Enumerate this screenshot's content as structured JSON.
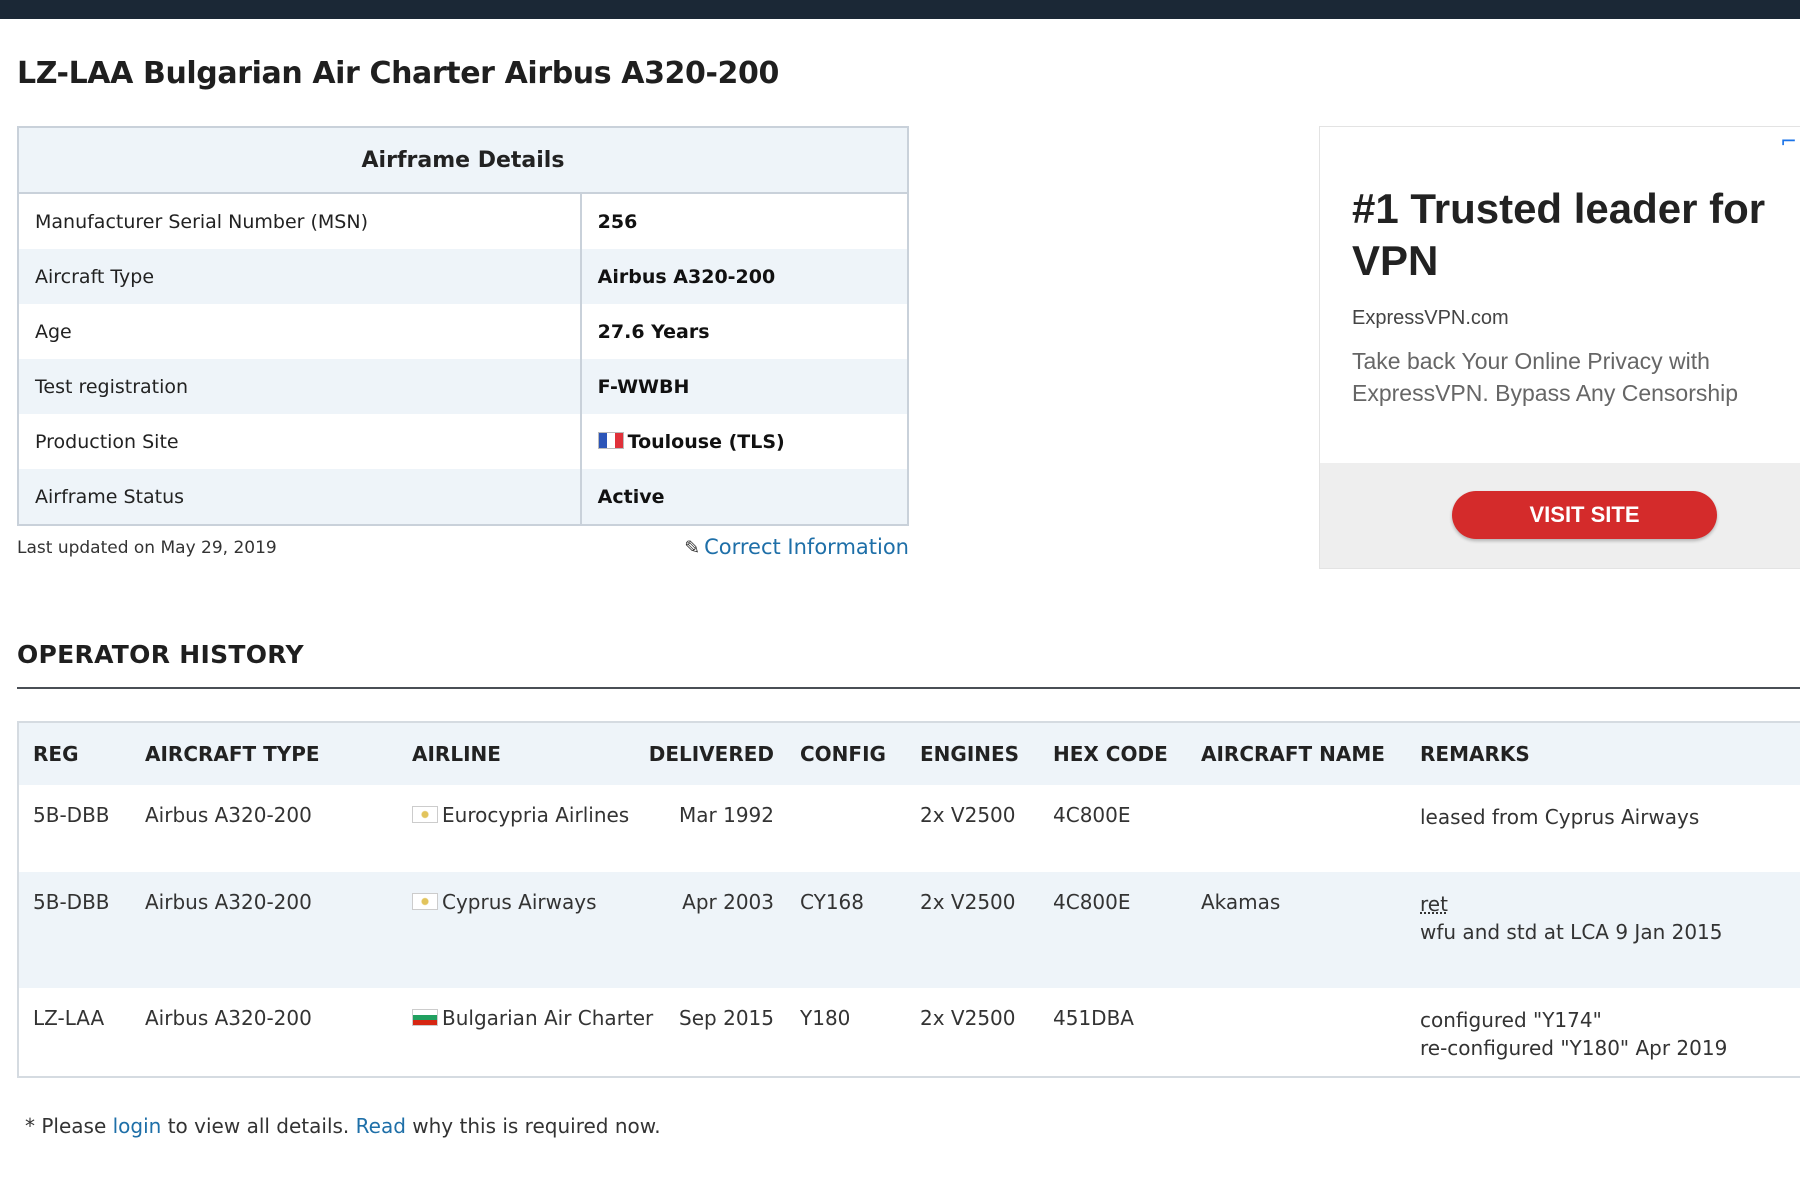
{
  "page": {
    "title": "LZ-LAA Bulgarian Air Charter Airbus A320-200"
  },
  "airframe": {
    "heading": "Airframe Details",
    "rows": [
      {
        "label": "Manufacturer Serial Number (MSN)",
        "value": "256"
      },
      {
        "label": "Aircraft Type",
        "value": "Airbus A320-200"
      },
      {
        "label": "Age",
        "value": "27.6 Years"
      },
      {
        "label": "Test registration",
        "value": "F-WWBH"
      },
      {
        "label": "Production Site",
        "value": "Toulouse (TLS)",
        "flag": "france-flag-icon"
      },
      {
        "label": "Airframe Status",
        "value": "Active"
      }
    ],
    "last_updated": "Last updated on May 29, 2019",
    "correct_link": "Correct Information",
    "correct_icon": "edit-icon"
  },
  "ad": {
    "headline": "#1 Trusted leader for VPN",
    "domain": "ExpressVPN.com",
    "body": "Take back Your Online Privacy with ExpressVPN. Bypass Any Censorship",
    "button": "VISIT SITE",
    "button_color": "#d42b2b",
    "corner_icon": "adchoices-icon"
  },
  "operator_history": {
    "heading": "OPERATOR HISTORY",
    "columns": [
      "REG",
      "AIRCRAFT TYPE",
      "AIRLINE",
      "DELIVERED",
      "CONFIG",
      "ENGINES",
      "HEX CODE",
      "AIRCRAFT NAME",
      "REMARKS"
    ],
    "rows": [
      {
        "reg": "5B-DBB",
        "type": "Airbus A320-200",
        "airline": "Eurocypria Airlines",
        "flag": "cyprus-flag-icon",
        "delivered": "Mar 1992",
        "config": "",
        "engines": "2x V2500",
        "hex": "4C800E",
        "name": "",
        "remarks": [
          "leased from Cyprus Airways"
        ]
      },
      {
        "reg": "5B-DBB",
        "type": "Airbus A320-200",
        "airline": "Cyprus Airways",
        "flag": "cyprus-flag-icon",
        "delivered": "Apr 2003",
        "config": "CY168",
        "engines": "2x V2500",
        "hex": "4C800E",
        "name": "Akamas",
        "remarks": [
          "ret",
          "wfu and std at LCA 9 Jan 2015"
        ]
      },
      {
        "reg": "LZ-LAA",
        "type": "Airbus A320-200",
        "airline": "Bulgarian Air Charter",
        "flag": "bulgaria-flag-icon",
        "delivered": "Sep 2015",
        "config": "Y180",
        "engines": "2x V2500",
        "hex": "451DBA",
        "name": "",
        "remarks": [
          "configured \"Y174\"",
          "re-configured \"Y180\" Apr 2019"
        ]
      }
    ]
  },
  "footer": {
    "prefix": "* Please",
    "login": "login",
    "middle": "to view all details.",
    "read": "Read",
    "suffix": "why this is required now."
  },
  "colors": {
    "link": "#1e6fa8",
    "header_bar": "#1b2836",
    "alt_row": "#eef4f9"
  }
}
